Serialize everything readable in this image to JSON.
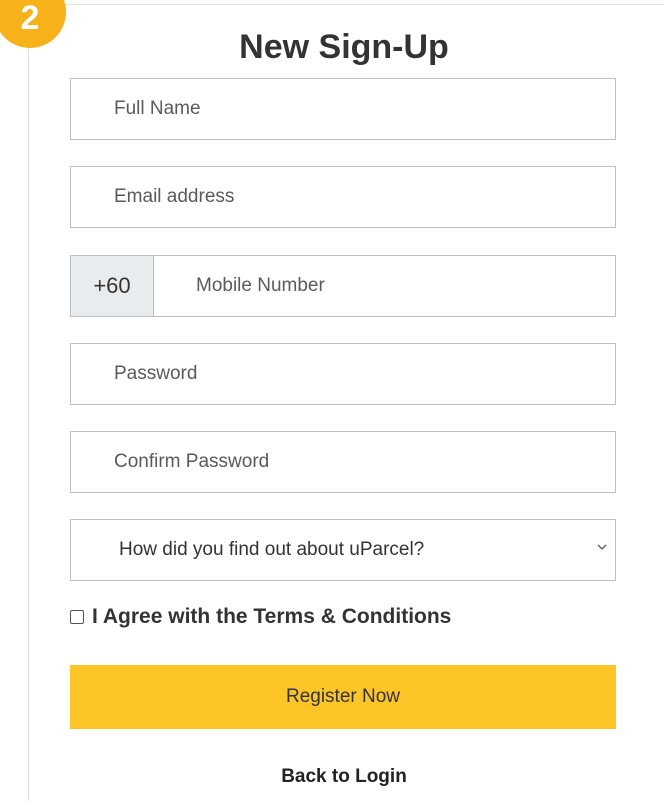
{
  "step": {
    "number": "2",
    "color": "#f7b21a"
  },
  "form": {
    "title": "New Sign-Up",
    "full_name": {
      "placeholder": "Full Name",
      "value": ""
    },
    "email": {
      "placeholder": "Email address",
      "value": ""
    },
    "mobile": {
      "country_code": "+60",
      "placeholder": "Mobile Number",
      "value": ""
    },
    "password": {
      "placeholder": "Password",
      "value": ""
    },
    "confirm_password": {
      "placeholder": "Confirm Password",
      "value": ""
    },
    "referral_source": {
      "selected": "How did you find out about uParcel?",
      "icon": "chevron-down-icon"
    },
    "terms": {
      "label": "I Agree with the Terms & Conditions",
      "checked": false
    },
    "register_label": "Register Now",
    "register_color": "#fdc526",
    "back_label": "Back to Login"
  }
}
